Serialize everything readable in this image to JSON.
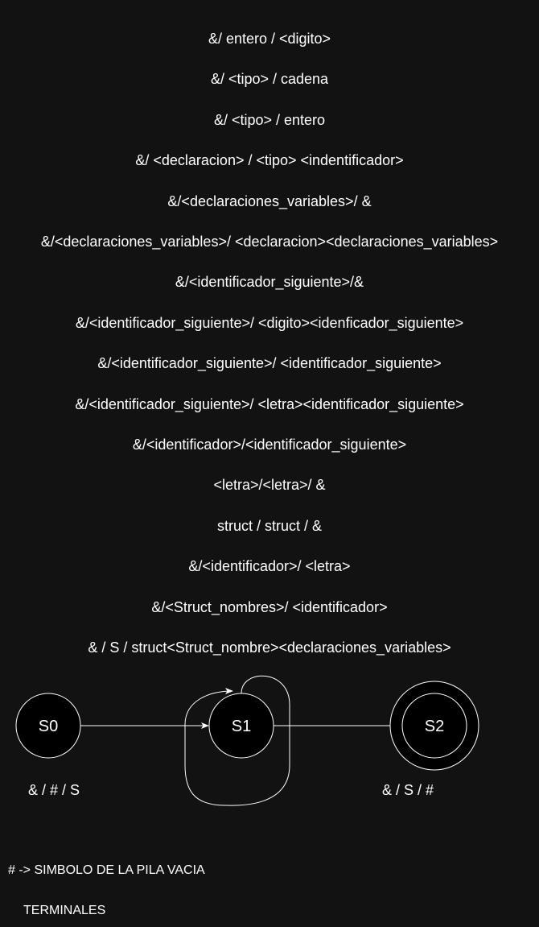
{
  "rules": [
    "&/ entero / <digito>",
    "&/ <tipo> / cadena",
    "&/ <tipo> / entero",
    "&/ <declaracion> / <tipo> <indentificador>",
    "&/<declaraciones_variables>/ &",
    "&/<declaraciones_variables>/ <declaracion><declaraciones_variables>",
    "&/<identificador_siguiente>/&",
    "&/<identificador_siguiente>/ <digito><idenficador_siguiente>",
    "&/<identificador_siguiente>/ <identificador_siguiente>",
    "&/<identificador_siguiente>/ <letra><identificador_siguiente>",
    "&/<identificador>/<identificador_siguiente>",
    "<letra>/<letra>/ &",
    "struct / struct / &",
    "&/<identificador>/ <letra>",
    "&/<Struct_nombres>/ <identificador>",
    "& / S / struct<Struct_nombre><declaraciones_variables>"
  ],
  "states": [
    {
      "id": "S0",
      "label": "S0",
      "accepting": false
    },
    {
      "id": "S1",
      "label": "S1",
      "accepting": false
    },
    {
      "id": "S2",
      "label": "S2",
      "accepting": true
    }
  ],
  "transitions": [
    {
      "from": "S0",
      "to": "S1",
      "label": "& / # / S"
    },
    {
      "from": "S1",
      "to": "S1",
      "label": ""
    },
    {
      "from": "S1",
      "to": "S2",
      "label": "& / S / #"
    }
  ],
  "notes": {
    "empty_stack": "# -> SIMBOLO DE LA PILA VACIA",
    "terminals": "TERMINALES"
  },
  "colors": {
    "background": "#121212",
    "foreground": "#ffffff",
    "state_fill": "#000000"
  }
}
